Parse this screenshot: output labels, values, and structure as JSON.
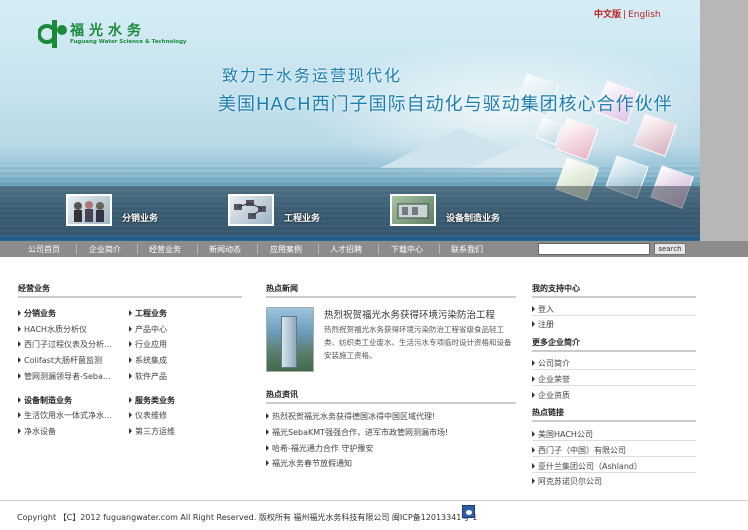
{
  "header": {
    "logo_cn": "福光水务",
    "logo_en": "Fuguang Water Science & Technology",
    "lang_cn": "中文版",
    "lang_sep": "|",
    "lang_en": "English",
    "slogan_line1": "致力于水务运营现代化",
    "slogan_line2": "美国HACH西门子国际自动化与驱动集团核心合作伙伴"
  },
  "services": [
    {
      "label": "分销业务"
    },
    {
      "label": "工程业务"
    },
    {
      "label": "设备制造业务"
    }
  ],
  "nav": {
    "items": [
      "公司首页",
      "企业简介",
      "经营业务",
      "新闻动态",
      "应用案例",
      "人才招聘",
      "下载中心",
      "联系我们"
    ],
    "search_button": "search",
    "search_value": ""
  },
  "business": {
    "title": "经营业务",
    "distribution": {
      "title": "分销业务",
      "items": [
        "HACH水质分析仪",
        "西门子过程仪表及分析...",
        "Colifast大肠杆菌监测",
        "管网测漏领导者-Seba..."
      ]
    },
    "engineering": {
      "title": "工程业务",
      "items": [
        "产品中心",
        "行业应用",
        "系统集成",
        "软件产品"
      ]
    },
    "manufacturing": {
      "title": "设备制造业务",
      "items": [
        "生活饮用水一体式净水...",
        "净水设备"
      ]
    },
    "service": {
      "title": "服务类业务",
      "items": [
        "仪表维修",
        "第三方运维"
      ]
    }
  },
  "hot_news": {
    "title": "热点新闻",
    "headline": "热烈祝贺福光水务获得环境污染防治工程",
    "body": "热烈祝贺福光水务获得环境污染防治工程省级食品轻工类、纺织类工业废水、生活污水专项临时设计资格和设备安装施工资格。"
  },
  "hot_info": {
    "title": "热点资讯",
    "items": [
      "热烈祝贺福光水务获得德国冰得中国区域代理!",
      "福光SebaKMT强强合作，进军市政管网测漏市场!",
      "哈希-福光通力合作 守护豫安",
      "福光水务春节放假通知"
    ]
  },
  "support": {
    "title": "我的支持中心",
    "items": [
      "登入",
      "注册"
    ]
  },
  "more": {
    "title": "更多企业简介",
    "items": [
      "公司简介",
      "企业荣誉",
      "企业资质"
    ]
  },
  "links": {
    "title": "热点链接",
    "items": [
      "美国HACH公司",
      "西门子（中国）有限公司",
      "亚什兰集团公司（Ashland）",
      "阿克苏诺贝尔公司"
    ]
  },
  "footer": {
    "text": "Copyright 【C】2012 fuguangwater.com  All Right Reserved. 版权所有 福州福光水务科技有限公司   闽ICP备12013341号-1"
  }
}
